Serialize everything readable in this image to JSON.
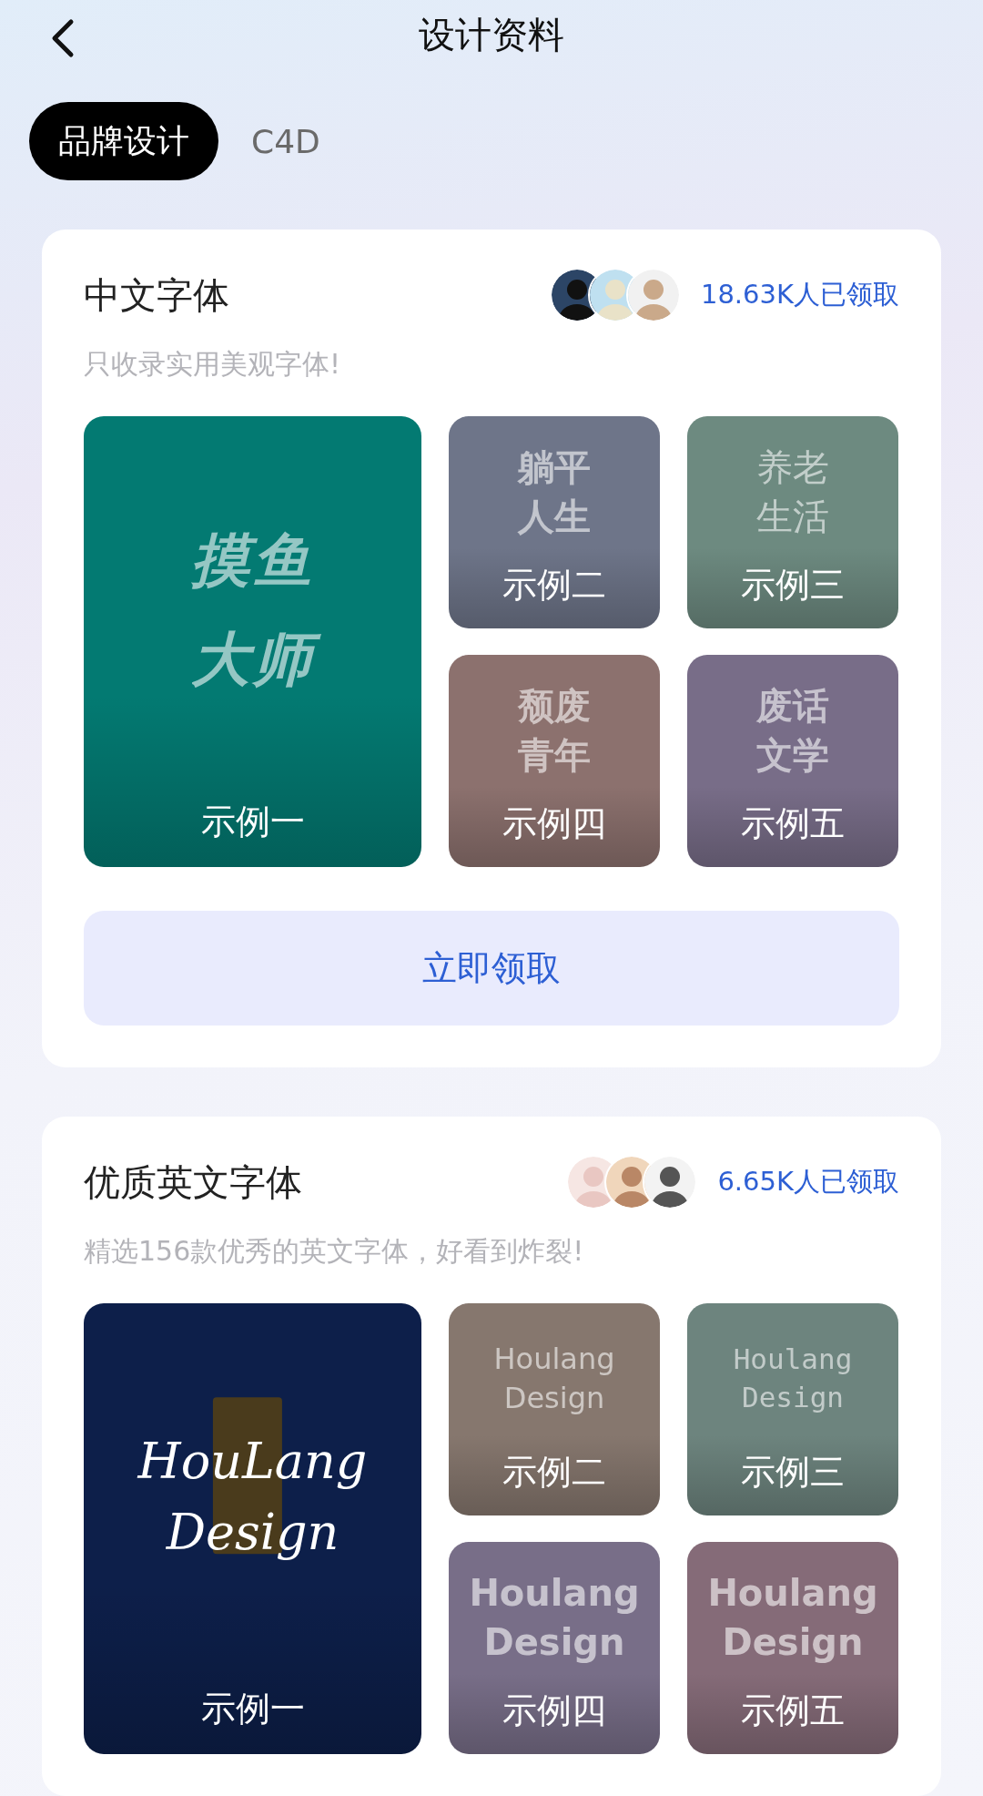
{
  "header": {
    "title": "设计资料"
  },
  "tabs": [
    {
      "label": "品牌设计",
      "selected": true
    },
    {
      "label": "C4D",
      "selected": false
    }
  ],
  "cards": [
    {
      "title": "中文字体",
      "subtitle": "只收录实用美观字体!",
      "claimed": "18.63K人已领取",
      "button": "立即领取",
      "tiles": [
        {
          "kind": "bold-italic",
          "sample": [
            "摸鱼",
            "大师"
          ],
          "label": "示例一",
          "color": "#037a72"
        },
        {
          "kind": "bold",
          "sample": [
            "躺平",
            "人生"
          ],
          "label": "示例二",
          "color": "#6e7589"
        },
        {
          "kind": "light",
          "sample": [
            "养老",
            "生活"
          ],
          "label": "示例三",
          "color": "#6d8a80"
        },
        {
          "kind": "heavy",
          "sample": [
            "颓废",
            "青年"
          ],
          "label": "示例四",
          "color": "#8c716e"
        },
        {
          "kind": "heavy",
          "sample": [
            "废话",
            "文学"
          ],
          "label": "示例五",
          "color": "#786d88"
        }
      ]
    },
    {
      "title": "优质英文字体",
      "subtitle": "精选156款优秀的英文字体，好看到炸裂!",
      "claimed": "6.65K人已领取",
      "tiles": [
        {
          "kind": "serif-italic",
          "sample": [
            "HouLang",
            "Design"
          ],
          "label": "示例一",
          "color": "#0d1f4a"
        },
        {
          "kind": "regular",
          "sample": [
            "Houlang",
            "Design"
          ],
          "label": "示例二",
          "color": "#86776e"
        },
        {
          "kind": "mono",
          "sample": [
            "Houlang",
            "Design"
          ],
          "label": "示例三",
          "color": "#6d847e"
        },
        {
          "kind": "bold",
          "sample": [
            "Houlang",
            "Design"
          ],
          "label": "示例四",
          "color": "#786e88"
        },
        {
          "kind": "heavy",
          "sample": [
            "Houlang",
            "Design"
          ],
          "label": "示例五",
          "color": "#856b78"
        }
      ]
    }
  ]
}
